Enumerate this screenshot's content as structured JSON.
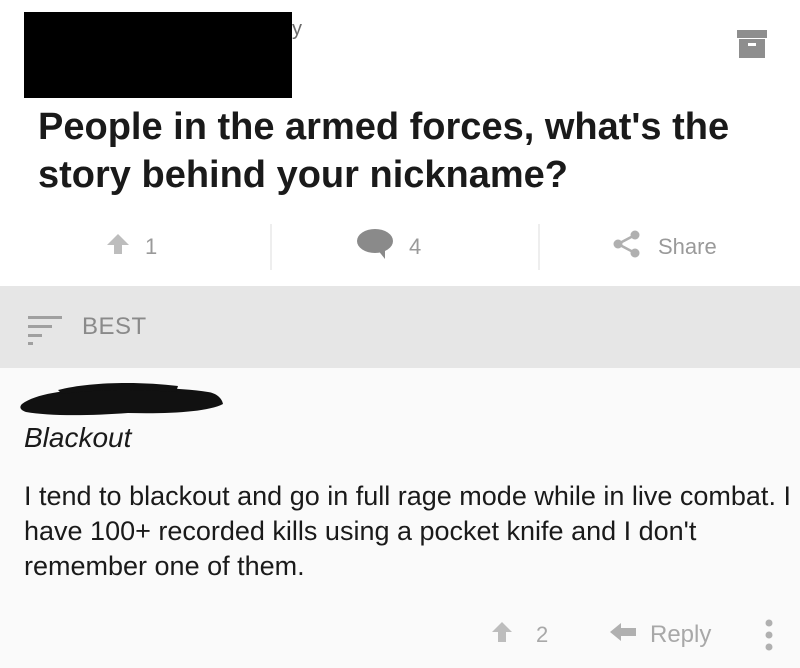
{
  "post": {
    "meta_fragment": "y",
    "title": "People in the armed forces, what's the story behind your nickname?",
    "upvotes": "1",
    "comments": "4",
    "share_label": "Share"
  },
  "icons": {
    "archive": "archive-icon",
    "upvote": "upvote-arrow-icon",
    "comment": "comment-bubble-icon",
    "share": "share-icon",
    "sort": "sort-icon",
    "reply": "reply-arrow-icon",
    "more": "more-vertical-icon"
  },
  "sort": {
    "label": "BEST"
  },
  "comment": {
    "title": "Blackout",
    "body": "I tend to blackout and go in full rage mode while in live combat. I have 100+ recorded kills using a pocket knife and I don't remember one of them.",
    "upvotes": "2",
    "reply_label": "Reply"
  },
  "colors": {
    "sort_bar_bg": "#e6e6e6",
    "muted_text": "#9a9a9a",
    "primary_text": "#1a1a1a"
  }
}
